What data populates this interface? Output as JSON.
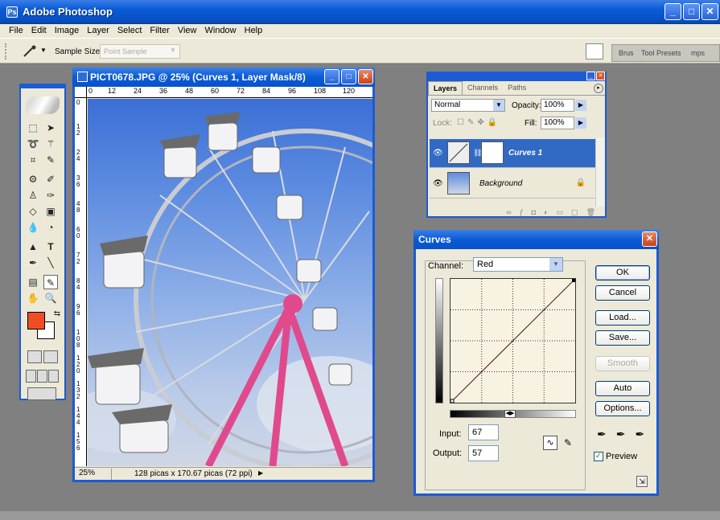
{
  "app": {
    "title": "Adobe Photoshop"
  },
  "menu": [
    "File",
    "Edit",
    "Image",
    "Layer",
    "Select",
    "Filter",
    "View",
    "Window",
    "Help"
  ],
  "options_bar": {
    "sample_size_label": "Sample Size:",
    "sample_size_value": "Point Sample",
    "well_tabs": [
      "Brus",
      "Tool Presets",
      "mps"
    ]
  },
  "document": {
    "title": "PICT0678.JPG @ 25% (Curves 1, Layer Mask/8)",
    "ruler_top": [
      "0",
      "12",
      "24",
      "36",
      "48",
      "60",
      "72",
      "84",
      "96",
      "108",
      "120"
    ],
    "ruler_left": [
      "0",
      "12",
      "24",
      "36",
      "48",
      "60",
      "72",
      "84",
      "96",
      "108",
      "120",
      "132",
      "144",
      "156"
    ],
    "zoom": "25%",
    "size": "128 picas x 170.67 picas (72 ppi)"
  },
  "layers_palette": {
    "tabs": [
      "Layers",
      "Channels",
      "Paths"
    ],
    "blend_mode": "Normal",
    "opacity_label": "Opacity:",
    "opacity_value": "100%",
    "lock_label": "Lock:",
    "fill_label": "Fill:",
    "fill_value": "100%",
    "layers": [
      {
        "name": "Curves 1",
        "selected": true
      },
      {
        "name": "Background",
        "selected": false
      }
    ]
  },
  "curves": {
    "title": "Curves",
    "channel_label": "Channel:",
    "channel_value": "Red",
    "input_label": "Input:",
    "input_value": "67",
    "output_label": "Output:",
    "output_value": "57",
    "buttons": {
      "ok": "OK",
      "cancel": "Cancel",
      "load": "Load...",
      "save": "Save...",
      "smooth": "Smooth",
      "auto": "Auto",
      "options": "Options..."
    },
    "preview_label": "Preview",
    "preview_checked": true
  },
  "colors": {
    "foreground": "#f04d23",
    "background": "#ffffff",
    "title_bar": "#0a5ad6",
    "selection": "#316ac5"
  }
}
